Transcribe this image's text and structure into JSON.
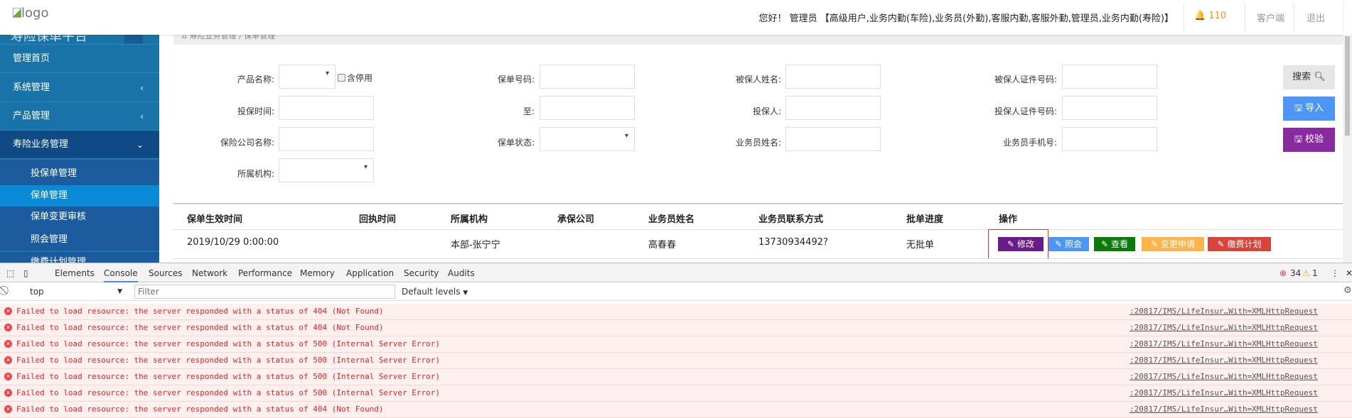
{
  "header": {
    "logo_alt": "logo",
    "greeting": "您好！ 管理员 【高级用户,业务内勤(车险),业务员(外勤),客服内勤,客服外勤,管理员,业务内勤(寿险)】",
    "notifications": "110",
    "client": "客户端",
    "logout": "退出"
  },
  "sidebar": {
    "brand": "寿险保单平台",
    "items": [
      {
        "label": "管理首页"
      },
      {
        "label": "系统管理"
      },
      {
        "label": "产品管理"
      },
      {
        "label": "寿险业务管理"
      }
    ],
    "subitems": [
      {
        "label": "投保单管理"
      },
      {
        "label": "保单管理"
      },
      {
        "label": "保单变更审核"
      },
      {
        "label": "照会管理"
      },
      {
        "label": "缴费计划管理"
      }
    ]
  },
  "breadcrumb": {
    "parent": "寿险业务管理",
    "sep": "/",
    "current": "保单管理"
  },
  "form": {
    "product_name": "产品名称:",
    "include_disabled": "含停用",
    "policy_no": "保单号码:",
    "insured_name": "被保人姓名:",
    "insured_id": "被保人证件号码:",
    "insure_time": "投保时间:",
    "to": "至:",
    "applicant": "投保人:",
    "applicant_id": "投保人证件号码:",
    "company": "保险公司名称:",
    "status": "保单状态:",
    "agent_name": "业务员姓名:",
    "agent_phone": "业务员手机号:",
    "org": "所属机构:"
  },
  "buttons": {
    "search": "搜索",
    "import": "导入",
    "verify": "校验"
  },
  "table": {
    "columns": [
      "保单生效时间",
      "回执时间",
      "所属机构",
      "承保公司",
      "业务员姓名",
      "业务员联系方式",
      "批单进度",
      "操作"
    ],
    "rows": [
      {
        "effective": "2019/10/29 0:00:00",
        "receipt": "",
        "org": "本部-张宁宁",
        "company": "",
        "agent": "高春春",
        "phone": "13730934492?",
        "progress": "无批单"
      }
    ],
    "actions": [
      "修改",
      "照会",
      "查看",
      "变更申请",
      "缴费计划"
    ]
  },
  "devtools": {
    "tabs": [
      "Elements",
      "Console",
      "Sources",
      "Network",
      "Performance",
      "Memory",
      "Application",
      "Security",
      "Audits"
    ],
    "errors": "34",
    "warnings": "1",
    "context": "top",
    "filter_placeholder": "Filter",
    "levels": "Default levels",
    "messages": [
      {
        "text": "Failed to load resource: the server responded with a status of 404 (Not Found)",
        "src": ":20817/IMS/LifeInsur…With=XMLHttpRequest"
      },
      {
        "text": "Failed to load resource: the server responded with a status of 404 (Not Found)",
        "src": ":20817/IMS/LifeInsur…With=XMLHttpRequest"
      },
      {
        "text": "Failed to load resource: the server responded with a status of 500 (Internal Server Error)",
        "src": ":20817/IMS/LifeInsur…With=XMLHttpRequest"
      },
      {
        "text": "Failed to load resource: the server responded with a status of 500 (Internal Server Error)",
        "src": ":20817/IMS/LifeInsur…With=XMLHttpRequest"
      },
      {
        "text": "Failed to load resource: the server responded with a status of 500 (Internal Server Error)",
        "src": ":20817/IMS/LifeInsur…With=XMLHttpRequest"
      },
      {
        "text": "Failed to load resource: the server responded with a status of 500 (Internal Server Error)",
        "src": ":20817/IMS/LifeInsur…With=XMLHttpRequest"
      },
      {
        "text": "Failed to load resource: the server responded with a status of 404 (Not Found)",
        "src": ":20817/IMS/LifeInsur…With=XMLHttpRequest"
      }
    ]
  }
}
